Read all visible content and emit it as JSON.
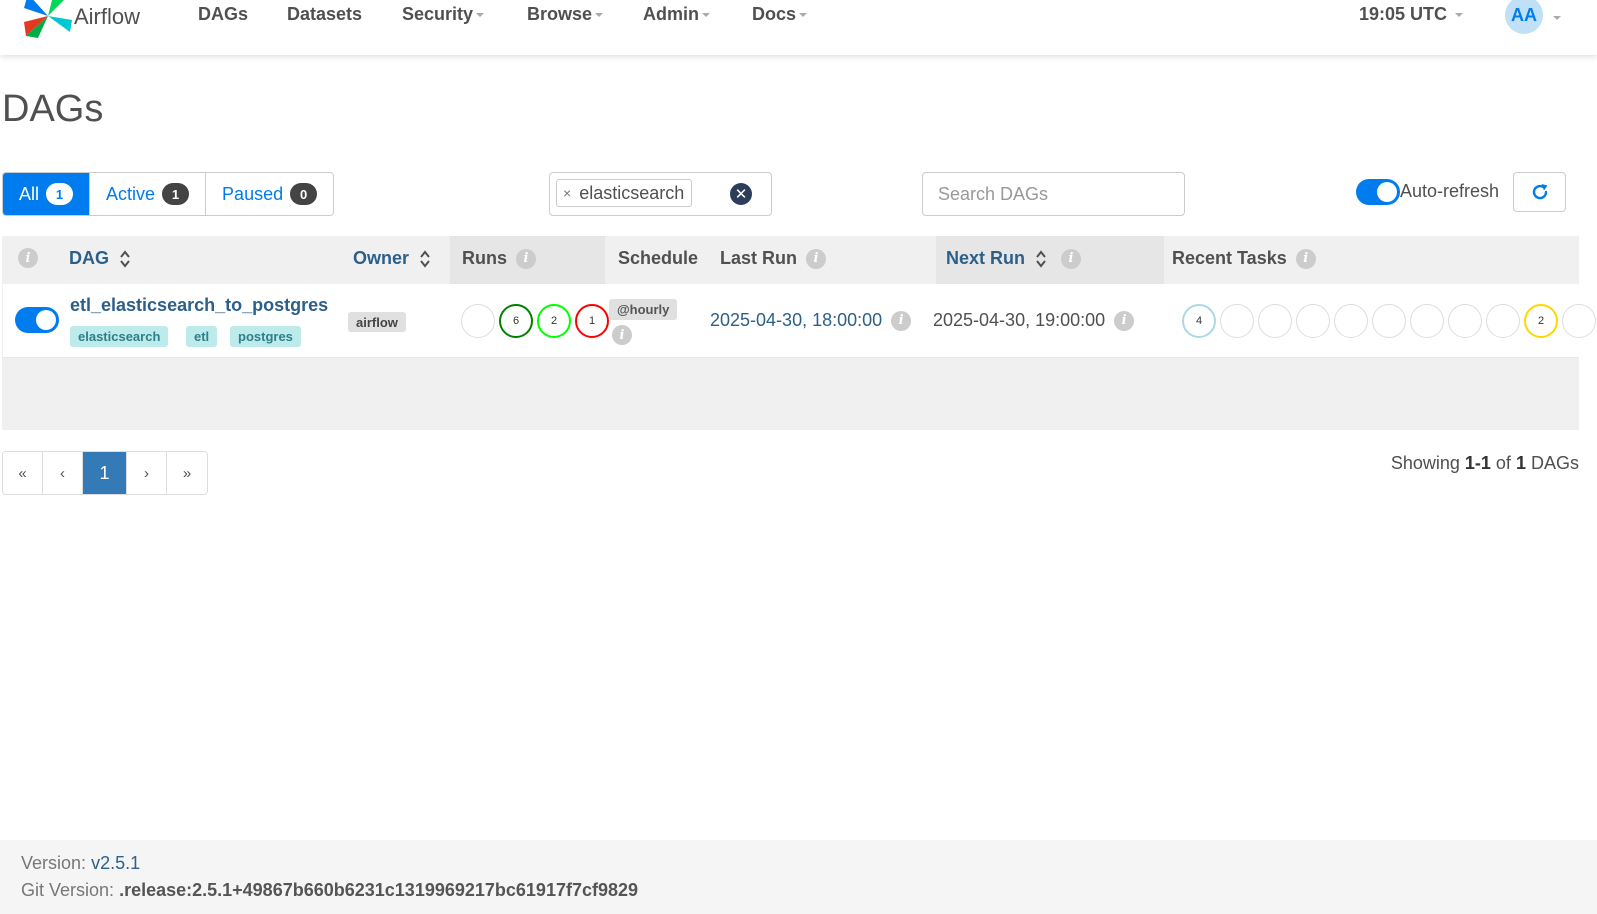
{
  "navbar": {
    "brand": "Airflow",
    "items": [
      {
        "label": "DAGs",
        "dropdown": false
      },
      {
        "label": "Datasets",
        "dropdown": false
      },
      {
        "label": "Security",
        "dropdown": true
      },
      {
        "label": "Browse",
        "dropdown": true
      },
      {
        "label": "Admin",
        "dropdown": true
      },
      {
        "label": "Docs",
        "dropdown": true
      }
    ],
    "time": "19:05 UTC",
    "user_initials": "AA"
  },
  "page_title": "DAGs",
  "status_filter": {
    "all": {
      "label": "All",
      "count": "1"
    },
    "active": {
      "label": "Active",
      "count": "1"
    },
    "paused": {
      "label": "Paused",
      "count": "0"
    }
  },
  "tag_filter": {
    "selected_tag": "elasticsearch",
    "remove_symbol": "×",
    "clear_symbol": "✕"
  },
  "search": {
    "placeholder": "Search DAGs",
    "value": ""
  },
  "auto_refresh": {
    "label": "Auto-refresh",
    "enabled": true
  },
  "table": {
    "headers": {
      "dag": "DAG",
      "owner": "Owner",
      "runs": "Runs",
      "schedule": "Schedule",
      "last_run": "Last Run",
      "next_run": "Next Run",
      "recent_tasks": "Recent Tasks"
    },
    "rows": [
      {
        "paused": false,
        "dag_id": "etl_elasticsearch_to_postgres",
        "tags": [
          "elasticsearch",
          "etl",
          "postgres"
        ],
        "owner": "airflow",
        "runs": [
          {
            "count": "",
            "color": "#dddddd"
          },
          {
            "count": "6",
            "color": "#008000"
          },
          {
            "count": "2",
            "color": "#00ff00"
          },
          {
            "count": "1",
            "color": "#ff0000"
          }
        ],
        "schedule": "@hourly",
        "last_run": "2025-04-30, 18:00:00",
        "next_run": "2025-04-30, 19:00:00",
        "recent_tasks": [
          {
            "count": "4",
            "color": "#add8e6"
          },
          {
            "count": "",
            "color": "#dddddd"
          },
          {
            "count": "",
            "color": "#dddddd"
          },
          {
            "count": "",
            "color": "#dddddd"
          },
          {
            "count": "",
            "color": "#dddddd"
          },
          {
            "count": "",
            "color": "#dddddd"
          },
          {
            "count": "",
            "color": "#dddddd"
          },
          {
            "count": "",
            "color": "#dddddd"
          },
          {
            "count": "",
            "color": "#dddddd"
          },
          {
            "count": "2",
            "color": "#ffd700"
          },
          {
            "count": "",
            "color": "#dddddd"
          }
        ]
      }
    ]
  },
  "pagination": {
    "first": "«",
    "prev": "‹",
    "current": "1",
    "next": "›",
    "last": "»"
  },
  "showing": {
    "prefix": "Showing",
    "range": "1-1",
    "of": "of",
    "total": "1",
    "suffix": "DAGs"
  },
  "footer": {
    "version_label": "Version:",
    "version": "v2.5.1",
    "git_label": "Git Version:",
    "git_version": ".release:2.5.1+49867b660b6231c1319969217bc61917f7cf9829"
  },
  "colors": {
    "primary": "#017cee",
    "link": "#2c5f8a",
    "header_bg": "#f0f0f0"
  }
}
